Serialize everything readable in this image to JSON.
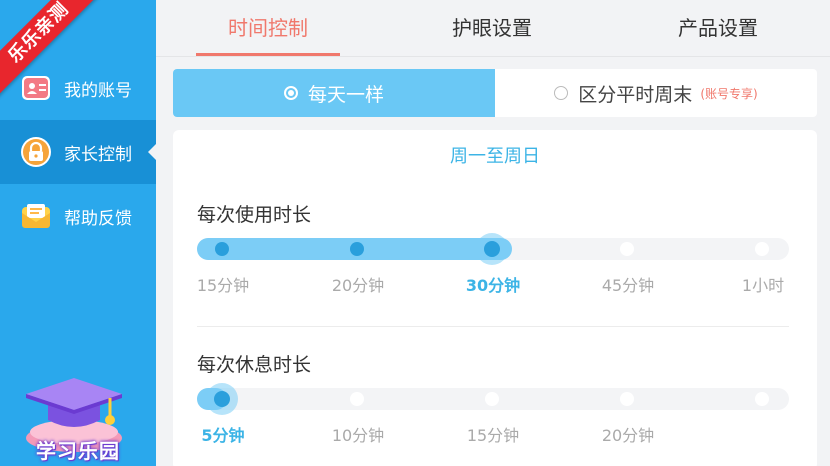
{
  "ribbon": "乐乐亲测",
  "sidebar": {
    "items": [
      {
        "label": "我的账号"
      },
      {
        "label": "家长控制"
      },
      {
        "label": "帮助反馈"
      }
    ],
    "promo_label": "学习乐园"
  },
  "tabs": [
    {
      "label": "时间控制"
    },
    {
      "label": "护眼设置"
    },
    {
      "label": "产品设置"
    }
  ],
  "mode": {
    "options": [
      {
        "label": "每天一样"
      },
      {
        "label": "区分平时周末",
        "badge": "(账号专享)"
      }
    ]
  },
  "card": {
    "title": "周一至周日",
    "usage": {
      "title": "每次使用时长",
      "ticks": [
        "15分钟",
        "20分钟",
        "30分钟",
        "45分钟",
        "1小时"
      ],
      "selected_index": 2
    },
    "rest": {
      "title": "每次休息时长",
      "ticks": [
        "5分钟",
        "10分钟",
        "15分钟",
        "20分钟"
      ],
      "selected_index": 0
    }
  },
  "colors": {
    "sidebar": "#2aa8ec",
    "sidebar_active": "#1890d6",
    "accent_red": "#f0786c",
    "accent_blue": "#3cb4e6",
    "mode_selected": "#6ac8f5"
  }
}
